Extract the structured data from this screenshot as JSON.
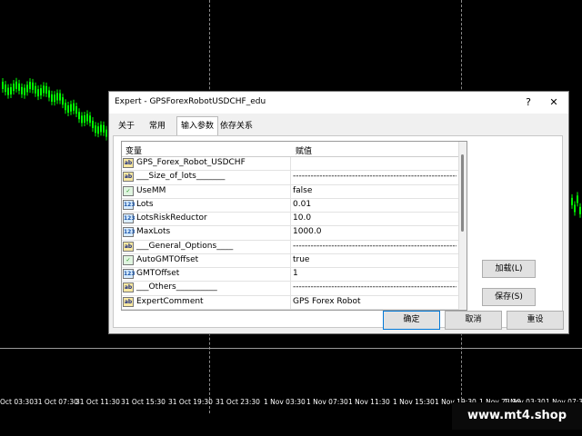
{
  "chart": {
    "time_axis": [
      "Oct 03:30",
      "31 Oct 07:30",
      "31 Oct 11:30",
      "31 Oct 15:30",
      "31 Oct 19:30",
      "31 Oct 23:30",
      "1 Nov 03:30",
      "1 Nov 07:30",
      "1 Nov 11:30",
      "1 Nov 15:30",
      "1 Nov 19:30",
      "1 Nov 23:30",
      "1 Nov 03:30",
      "1 Nov 07:30"
    ],
    "watermark": "www.mt4.shop",
    "colors": {
      "background": "#000000",
      "bull_candle": "#00ff00",
      "grid": "#8a8a8a"
    }
  },
  "dialog": {
    "title": "Expert - GPSForexRobotUSDCHF_edu",
    "help_glyph": "?",
    "close_glyph": "✕",
    "tabs": [
      "关于",
      "常用",
      "输入参数",
      "依存关系"
    ],
    "active_tab": "输入参数",
    "grid": {
      "col_name": "变量",
      "col_value": "赋值",
      "rows": [
        {
          "icon": "ab",
          "name": "GPS_Forex_Robot_USDCHF",
          "value": ""
        },
        {
          "icon": "ab",
          "name": "___Size_of_lots_______",
          "value": "--------------------------------------------------------"
        },
        {
          "icon": "bool",
          "name": "UseMM",
          "value": "false"
        },
        {
          "icon": "num",
          "name": "Lots",
          "value": "0.01"
        },
        {
          "icon": "num",
          "name": "LotsRiskReductor",
          "value": "10.0"
        },
        {
          "icon": "num",
          "name": "MaxLots",
          "value": "1000.0"
        },
        {
          "icon": "ab",
          "name": "___General_Options____",
          "value": "--------------------------------------------------------"
        },
        {
          "icon": "bool",
          "name": "AutoGMTOffset",
          "value": "true"
        },
        {
          "icon": "num",
          "name": "GMTOffset",
          "value": "1"
        },
        {
          "icon": "ab",
          "name": "___Others__________",
          "value": "--------------------------------------------------------"
        },
        {
          "icon": "ab",
          "name": "ExpertComment",
          "value": "GPS Forex Robot"
        }
      ]
    },
    "buttons": {
      "load": "加载(L)",
      "save": "保存(S)",
      "ok": "确定",
      "cancel": "取消",
      "reset": "重设"
    },
    "icon_text": {
      "ab": "ab",
      "num": "123",
      "bool": "✓"
    }
  }
}
